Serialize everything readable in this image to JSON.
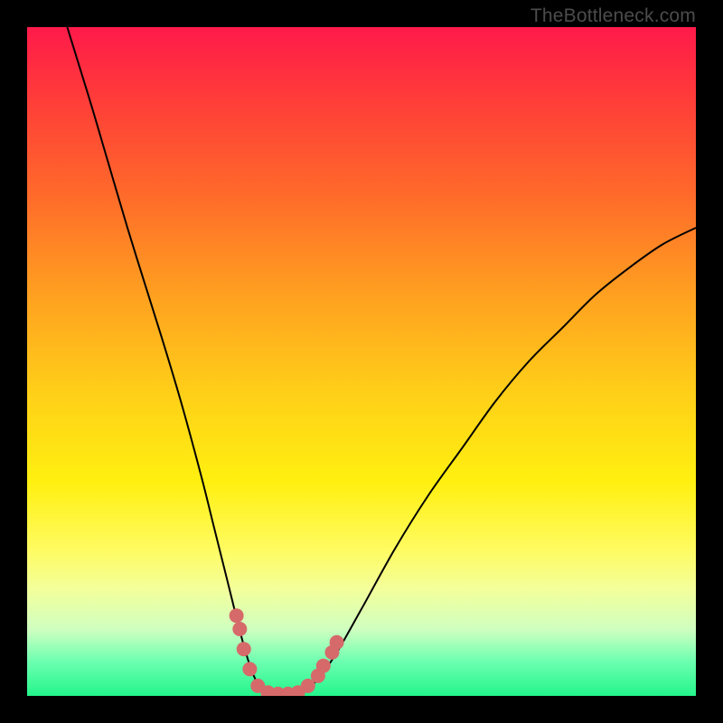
{
  "watermark": "TheBottleneck.com",
  "chart_data": {
    "type": "line",
    "title": "",
    "xlabel": "",
    "ylabel": "",
    "xlim": [
      0,
      100
    ],
    "ylim": [
      0,
      100
    ],
    "series": [
      {
        "name": "bottleneck-curve",
        "x": [
          6,
          10,
          15,
          20,
          23,
          26,
          28,
          30,
          32,
          33.5,
          35,
          37,
          39,
          41,
          43,
          46,
          50,
          55,
          60,
          65,
          70,
          75,
          80,
          85,
          90,
          95,
          100
        ],
        "y": [
          100,
          87,
          70,
          54,
          44,
          33,
          25,
          17,
          9,
          4,
          1,
          0,
          0,
          0.5,
          2,
          6,
          13,
          22,
          30,
          37,
          44,
          50,
          55,
          60,
          64,
          67.5,
          70
        ],
        "color": "#000000",
        "width": 2
      }
    ],
    "markers": {
      "name": "highlight-dots",
      "points": [
        {
          "x": 31.3,
          "y": 12
        },
        {
          "x": 31.8,
          "y": 10
        },
        {
          "x": 32.4,
          "y": 7
        },
        {
          "x": 33.3,
          "y": 4
        },
        {
          "x": 34.5,
          "y": 1.5
        },
        {
          "x": 36.0,
          "y": 0.5
        },
        {
          "x": 37.5,
          "y": 0.3
        },
        {
          "x": 39.0,
          "y": 0.3
        },
        {
          "x": 40.5,
          "y": 0.5
        },
        {
          "x": 42.0,
          "y": 1.5
        },
        {
          "x": 43.5,
          "y": 3
        },
        {
          "x": 44.3,
          "y": 4.5
        },
        {
          "x": 45.6,
          "y": 6.5
        },
        {
          "x": 46.3,
          "y": 8
        }
      ],
      "color": "#d66a6a",
      "radius": 8
    },
    "background_gradient": {
      "top": "#ff1a4a",
      "bottom": "#24f58a"
    }
  }
}
